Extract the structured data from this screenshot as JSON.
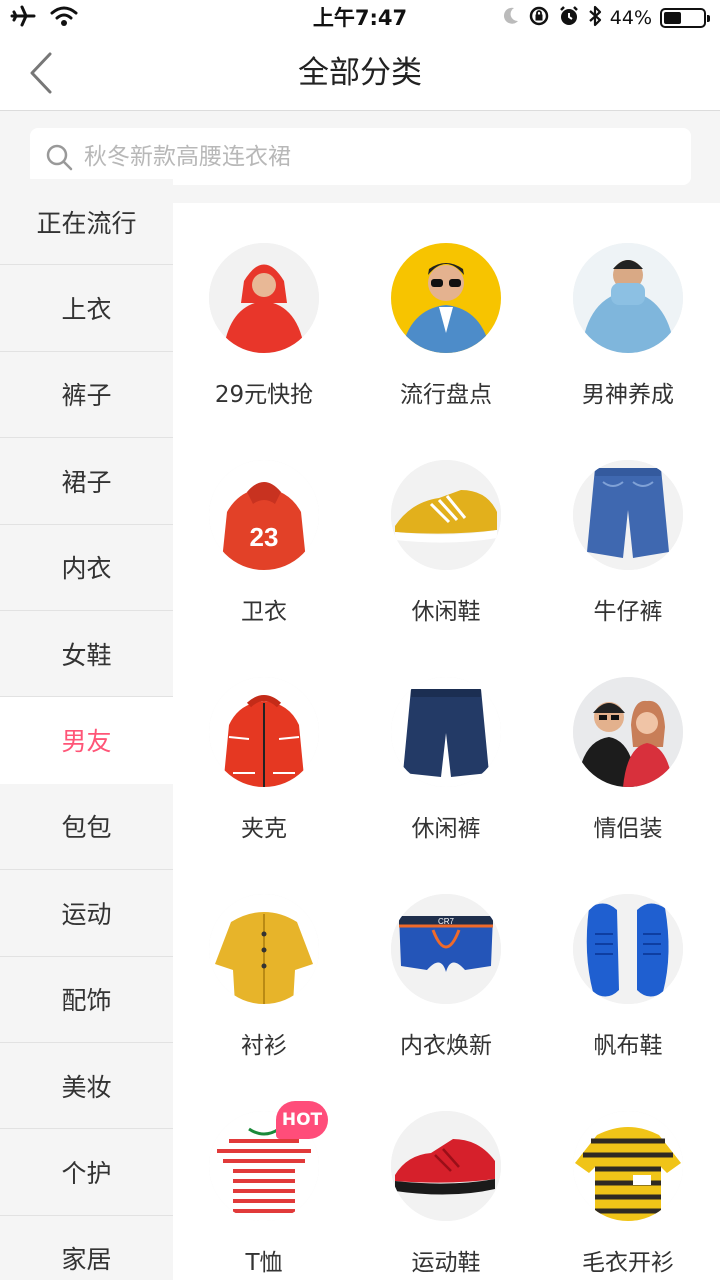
{
  "status_bar": {
    "time": "上午7:47",
    "battery_text": "44%",
    "battery_level": 0.44,
    "icons": [
      "airplane-icon",
      "wifi-icon",
      "moon-icon",
      "rotation-lock-icon",
      "alarm-icon",
      "bluetooth-icon",
      "battery-icon"
    ]
  },
  "nav": {
    "title": "全部分类",
    "back_icon": "chevron-left-icon"
  },
  "search": {
    "placeholder": "秋冬新款高腰连衣裙",
    "value": ""
  },
  "sidebar": {
    "active_color": "#ff5577",
    "items": [
      {
        "label": "正在流行"
      },
      {
        "label": "上衣"
      },
      {
        "label": "裤子"
      },
      {
        "label": "裙子"
      },
      {
        "label": "内衣"
      },
      {
        "label": "女鞋"
      },
      {
        "label": "男友",
        "active": true
      },
      {
        "label": "包包"
      },
      {
        "label": "运动"
      },
      {
        "label": "配饰"
      },
      {
        "label": "美妆"
      },
      {
        "label": "个护"
      },
      {
        "label": "家居"
      }
    ]
  },
  "grid": {
    "items": [
      {
        "label": "29元快抢",
        "image": "red-hoodie-model"
      },
      {
        "label": "流行盘点",
        "image": "sunglasses-model"
      },
      {
        "label": "男神养成",
        "image": "blue-sweater-model"
      },
      {
        "label": "卫衣",
        "image": "hoodie"
      },
      {
        "label": "休闲鞋",
        "image": "yellow-sneaker"
      },
      {
        "label": "牛仔裤",
        "image": "denim-shorts"
      },
      {
        "label": "夹克",
        "image": "red-jacket"
      },
      {
        "label": "休闲裤",
        "image": "navy-shorts"
      },
      {
        "label": "情侣装",
        "image": "couple"
      },
      {
        "label": "衬衫",
        "image": "mustard-shirt"
      },
      {
        "label": "内衣焕新",
        "image": "boxer-briefs"
      },
      {
        "label": "帆布鞋",
        "image": "blue-canvas-shoes"
      },
      {
        "label": "T恤",
        "image": "striped-tshirt"
      },
      {
        "label": "运动鞋",
        "image": "red-running-shoe"
      },
      {
        "label": "毛衣开衫",
        "image": "striped-sweater"
      }
    ],
    "hot_badge": "HOT"
  }
}
